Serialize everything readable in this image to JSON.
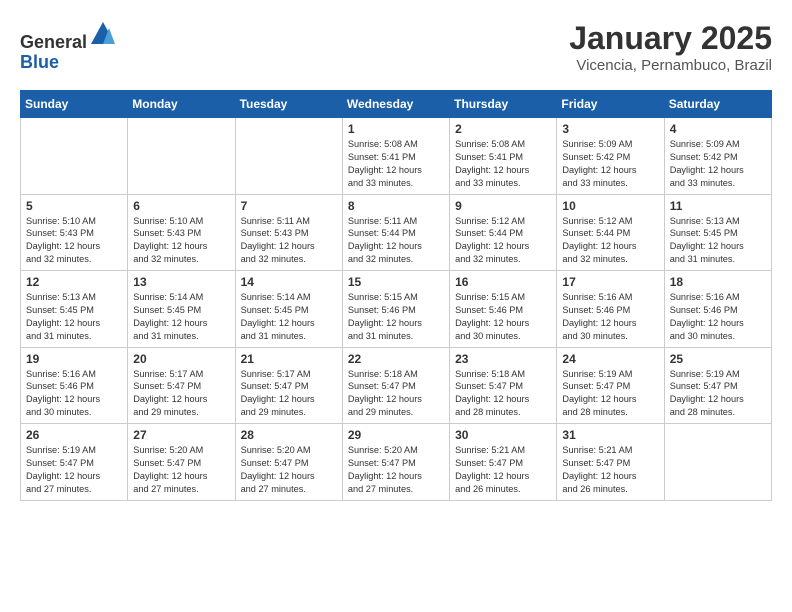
{
  "header": {
    "logo_line1": "General",
    "logo_line2": "Blue",
    "month_year": "January 2025",
    "location": "Vicencia, Pernambuco, Brazil"
  },
  "days_of_week": [
    "Sunday",
    "Monday",
    "Tuesday",
    "Wednesday",
    "Thursday",
    "Friday",
    "Saturday"
  ],
  "weeks": [
    {
      "days": [
        {
          "num": "",
          "info": ""
        },
        {
          "num": "",
          "info": ""
        },
        {
          "num": "",
          "info": ""
        },
        {
          "num": "1",
          "info": "Sunrise: 5:08 AM\nSunset: 5:41 PM\nDaylight: 12 hours\nand 33 minutes."
        },
        {
          "num": "2",
          "info": "Sunrise: 5:08 AM\nSunset: 5:41 PM\nDaylight: 12 hours\nand 33 minutes."
        },
        {
          "num": "3",
          "info": "Sunrise: 5:09 AM\nSunset: 5:42 PM\nDaylight: 12 hours\nand 33 minutes."
        },
        {
          "num": "4",
          "info": "Sunrise: 5:09 AM\nSunset: 5:42 PM\nDaylight: 12 hours\nand 33 minutes."
        }
      ]
    },
    {
      "days": [
        {
          "num": "5",
          "info": "Sunrise: 5:10 AM\nSunset: 5:43 PM\nDaylight: 12 hours\nand 32 minutes."
        },
        {
          "num": "6",
          "info": "Sunrise: 5:10 AM\nSunset: 5:43 PM\nDaylight: 12 hours\nand 32 minutes."
        },
        {
          "num": "7",
          "info": "Sunrise: 5:11 AM\nSunset: 5:43 PM\nDaylight: 12 hours\nand 32 minutes."
        },
        {
          "num": "8",
          "info": "Sunrise: 5:11 AM\nSunset: 5:44 PM\nDaylight: 12 hours\nand 32 minutes."
        },
        {
          "num": "9",
          "info": "Sunrise: 5:12 AM\nSunset: 5:44 PM\nDaylight: 12 hours\nand 32 minutes."
        },
        {
          "num": "10",
          "info": "Sunrise: 5:12 AM\nSunset: 5:44 PM\nDaylight: 12 hours\nand 32 minutes."
        },
        {
          "num": "11",
          "info": "Sunrise: 5:13 AM\nSunset: 5:45 PM\nDaylight: 12 hours\nand 31 minutes."
        }
      ]
    },
    {
      "days": [
        {
          "num": "12",
          "info": "Sunrise: 5:13 AM\nSunset: 5:45 PM\nDaylight: 12 hours\nand 31 minutes."
        },
        {
          "num": "13",
          "info": "Sunrise: 5:14 AM\nSunset: 5:45 PM\nDaylight: 12 hours\nand 31 minutes."
        },
        {
          "num": "14",
          "info": "Sunrise: 5:14 AM\nSunset: 5:45 PM\nDaylight: 12 hours\nand 31 minutes."
        },
        {
          "num": "15",
          "info": "Sunrise: 5:15 AM\nSunset: 5:46 PM\nDaylight: 12 hours\nand 31 minutes."
        },
        {
          "num": "16",
          "info": "Sunrise: 5:15 AM\nSunset: 5:46 PM\nDaylight: 12 hours\nand 30 minutes."
        },
        {
          "num": "17",
          "info": "Sunrise: 5:16 AM\nSunset: 5:46 PM\nDaylight: 12 hours\nand 30 minutes."
        },
        {
          "num": "18",
          "info": "Sunrise: 5:16 AM\nSunset: 5:46 PM\nDaylight: 12 hours\nand 30 minutes."
        }
      ]
    },
    {
      "days": [
        {
          "num": "19",
          "info": "Sunrise: 5:16 AM\nSunset: 5:46 PM\nDaylight: 12 hours\nand 30 minutes."
        },
        {
          "num": "20",
          "info": "Sunrise: 5:17 AM\nSunset: 5:47 PM\nDaylight: 12 hours\nand 29 minutes."
        },
        {
          "num": "21",
          "info": "Sunrise: 5:17 AM\nSunset: 5:47 PM\nDaylight: 12 hours\nand 29 minutes."
        },
        {
          "num": "22",
          "info": "Sunrise: 5:18 AM\nSunset: 5:47 PM\nDaylight: 12 hours\nand 29 minutes."
        },
        {
          "num": "23",
          "info": "Sunrise: 5:18 AM\nSunset: 5:47 PM\nDaylight: 12 hours\nand 28 minutes."
        },
        {
          "num": "24",
          "info": "Sunrise: 5:19 AM\nSunset: 5:47 PM\nDaylight: 12 hours\nand 28 minutes."
        },
        {
          "num": "25",
          "info": "Sunrise: 5:19 AM\nSunset: 5:47 PM\nDaylight: 12 hours\nand 28 minutes."
        }
      ]
    },
    {
      "days": [
        {
          "num": "26",
          "info": "Sunrise: 5:19 AM\nSunset: 5:47 PM\nDaylight: 12 hours\nand 27 minutes."
        },
        {
          "num": "27",
          "info": "Sunrise: 5:20 AM\nSunset: 5:47 PM\nDaylight: 12 hours\nand 27 minutes."
        },
        {
          "num": "28",
          "info": "Sunrise: 5:20 AM\nSunset: 5:47 PM\nDaylight: 12 hours\nand 27 minutes."
        },
        {
          "num": "29",
          "info": "Sunrise: 5:20 AM\nSunset: 5:47 PM\nDaylight: 12 hours\nand 27 minutes."
        },
        {
          "num": "30",
          "info": "Sunrise: 5:21 AM\nSunset: 5:47 PM\nDaylight: 12 hours\nand 26 minutes."
        },
        {
          "num": "31",
          "info": "Sunrise: 5:21 AM\nSunset: 5:47 PM\nDaylight: 12 hours\nand 26 minutes."
        },
        {
          "num": "",
          "info": ""
        }
      ]
    }
  ]
}
